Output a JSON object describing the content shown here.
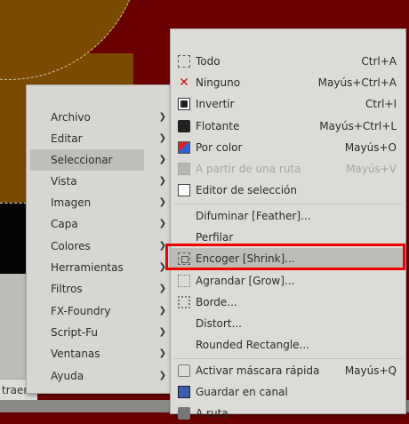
{
  "statusbar": {
    "text": "traer"
  },
  "main_menu": {
    "items": [
      {
        "label": "Archivo"
      },
      {
        "label": "Editar"
      },
      {
        "label": "Seleccionar"
      },
      {
        "label": "Vista"
      },
      {
        "label": "Imagen"
      },
      {
        "label": "Capa"
      },
      {
        "label": "Colores"
      },
      {
        "label": "Herramientas"
      },
      {
        "label": "Filtros"
      },
      {
        "label": "FX-Foundry"
      },
      {
        "label": "Script-Fu"
      },
      {
        "label": "Ventanas"
      },
      {
        "label": "Ayuda"
      }
    ],
    "arrow": "❯"
  },
  "select_menu": {
    "items": [
      {
        "label": "Todo",
        "accel": "Ctrl+A",
        "icon": "select-all-icon"
      },
      {
        "label": "Ninguno",
        "accel": "Mayús+Ctrl+A",
        "icon": "select-none-icon"
      },
      {
        "label": "Invertir",
        "accel": "Ctrl+I",
        "icon": "invert-icon"
      },
      {
        "label": "Flotante",
        "accel": "Mayús+Ctrl+L",
        "icon": "float-icon"
      },
      {
        "label": "Por color",
        "accel": "Mayús+O",
        "icon": "by-color-icon"
      },
      {
        "label": "A partir de una ruta",
        "accel": "Mayús+V",
        "icon": "from-path-icon"
      },
      {
        "label": "Editor de selección",
        "accel": "",
        "icon": "selection-editor-icon"
      },
      {
        "label": "Difuminar [Feather]...",
        "accel": ""
      },
      {
        "label": "Perfilar",
        "accel": ""
      },
      {
        "label": "Encoger [Shrink]...",
        "accel": "",
        "icon": "shrink-icon"
      },
      {
        "label": "Agrandar [Grow]...",
        "accel": "",
        "icon": "grow-icon"
      },
      {
        "label": "Borde...",
        "accel": "",
        "icon": "border-icon"
      },
      {
        "label": "Distort...",
        "accel": ""
      },
      {
        "label": "Rounded Rectangle...",
        "accel": ""
      },
      {
        "label": "Activar máscara rápida",
        "accel": "Mayús+Q",
        "icon": "quick-mask-icon"
      },
      {
        "label": "Guardar en canal",
        "accel": "",
        "icon": "save-channel-icon"
      },
      {
        "label": "A ruta",
        "accel": "",
        "icon": "to-path-icon"
      }
    ]
  },
  "colors": {
    "highlight_box": "#ee0000",
    "canvas_red": "#6b0000",
    "canvas_brown": "#7a4a00"
  }
}
